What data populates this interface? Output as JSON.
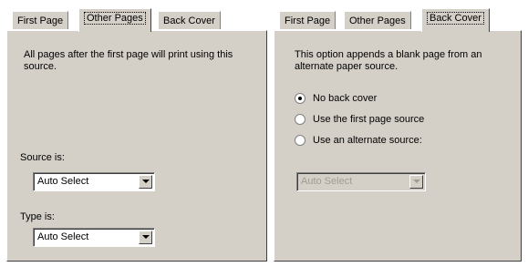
{
  "left_dialog": {
    "tabs": [
      {
        "label": "First Page"
      },
      {
        "label": "Other Pages"
      },
      {
        "label": "Back Cover"
      }
    ],
    "active_tab": "Other Pages",
    "description": "All pages after the first page will print using this source.",
    "source_label": "Source is:",
    "source_value": "Auto Select",
    "type_label": "Type is:",
    "type_value": "Auto Select"
  },
  "right_dialog": {
    "tabs": [
      {
        "label": "First Page"
      },
      {
        "label": "Other Pages"
      },
      {
        "label": "Back Cover"
      }
    ],
    "active_tab": "Back Cover",
    "description": "This option appends a blank page from an alternate paper source.",
    "options": [
      {
        "label": "No back cover",
        "selected": true
      },
      {
        "label": "Use the first page source",
        "selected": false
      },
      {
        "label": "Use an alternate source:",
        "selected": false
      }
    ],
    "alternate_source_value": "Auto Select",
    "alternate_source_enabled": false
  }
}
